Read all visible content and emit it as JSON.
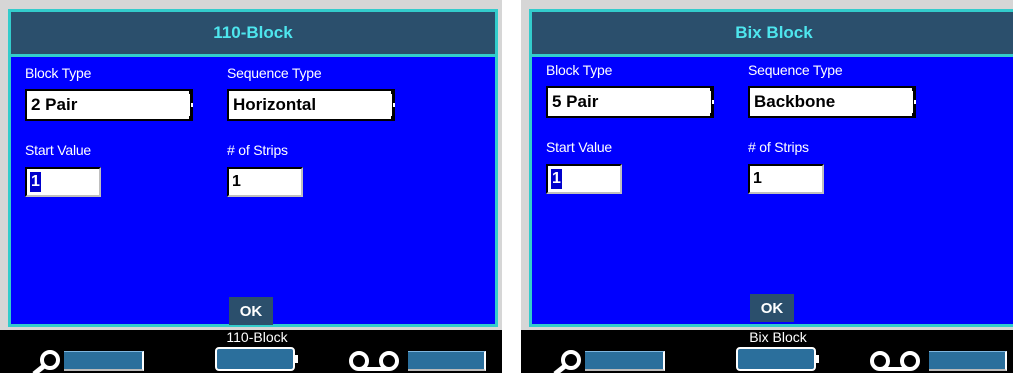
{
  "screens": [
    {
      "title": "110-Block",
      "block_type_label": "Block Type",
      "block_type_value": "2 Pair",
      "sequence_type_label": "Sequence Type",
      "sequence_type_value": "Horizontal",
      "start_value_label": "Start Value",
      "start_value": "1",
      "strips_label": "# of Strips",
      "strips_value": "1",
      "ok_label": "OK",
      "status_text": "110-Block"
    },
    {
      "title": "Bix Block",
      "block_type_label": "Block Type",
      "block_type_value": "5 Pair",
      "sequence_type_label": "Sequence Type",
      "sequence_type_value": "Backbone",
      "start_value_label": "Start Value",
      "start_value": "1",
      "strips_label": "# of Strips",
      "strips_value": "1",
      "ok_label": "OK",
      "status_text": "Bix Block"
    }
  ],
  "icons": {
    "left_softkey": "search-icon",
    "right_softkey": "voicemail-icon",
    "center_softkey": "battery-icon"
  },
  "colors": {
    "dialog_bg": "#0000ff",
    "titlebar_bg": "#2b4f6c",
    "title_text": "#4ee6ee",
    "border_accent": "#33cccc",
    "softkey_bg": "#2b6f9c"
  }
}
